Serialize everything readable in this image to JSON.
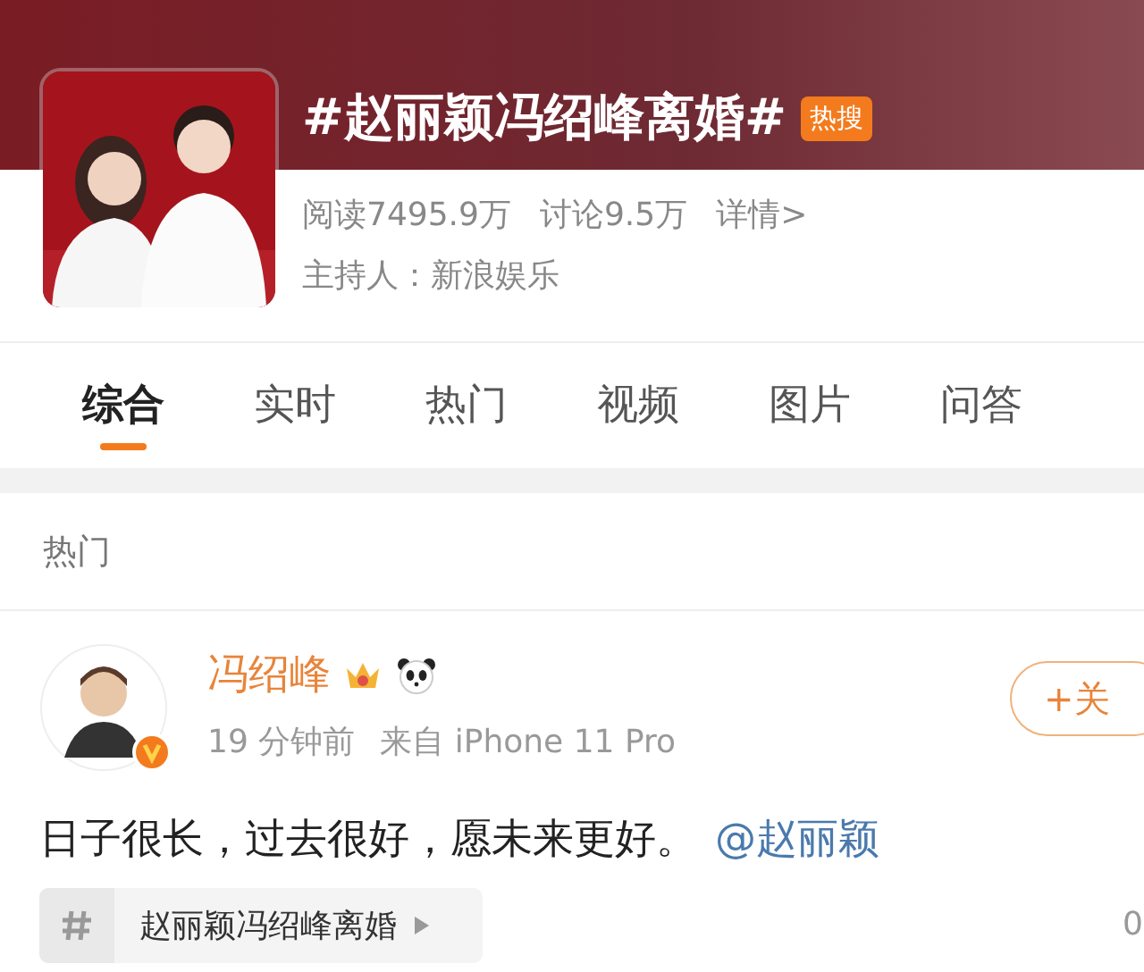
{
  "topic": {
    "title": "#赵丽颖冯绍峰离婚#",
    "badge": "热搜",
    "reads": "阅读7495.9万",
    "discussions": "讨论9.5万",
    "details": "详情>",
    "host": "主持人：新浪娱乐"
  },
  "tabs": [
    {
      "label": "综合",
      "selected": true
    },
    {
      "label": "实时",
      "selected": false
    },
    {
      "label": "热门",
      "selected": false
    },
    {
      "label": "视频",
      "selected": false
    },
    {
      "label": "图片",
      "selected": false
    },
    {
      "label": "问答",
      "selected": false
    }
  ],
  "section_title": "热门",
  "post": {
    "author": "冯绍峰",
    "verified": true,
    "time": "19 分钟前",
    "source": "来自 iPhone 11 Pro",
    "follow": "+关",
    "text": "日子很长，过去很好，愿未来更好。",
    "mention": "@赵丽颖",
    "topic_chip": "赵丽颖冯绍峰离婚",
    "count": "0"
  }
}
